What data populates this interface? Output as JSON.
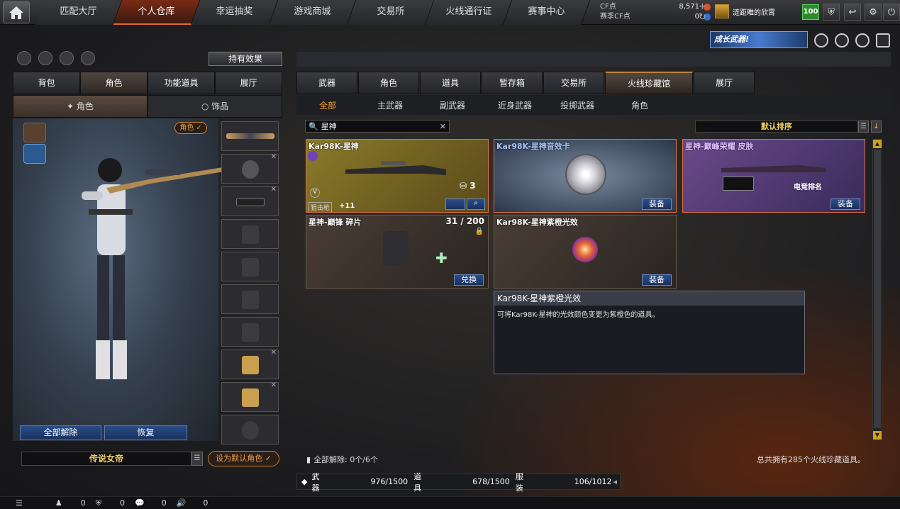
{
  "nav": {
    "tabs": [
      "匹配大厅",
      "个人仓库",
      "幸运抽奖",
      "游戏商城",
      "交易所",
      "火线通行证",
      "赛事中心"
    ],
    "active": 1
  },
  "currency": {
    "cf_label": "CF点",
    "cf_value": "8,571",
    "event_label": "赛季CF点",
    "event_value": "0"
  },
  "user": {
    "name": "涟距睢的欣霄",
    "level": "100"
  },
  "banner": {
    "text": "成长武器!"
  },
  "left": {
    "effect_button": "持有效果",
    "tabs": [
      "背包",
      "角色",
      "功能道具",
      "展厅"
    ],
    "active_tab": 1,
    "subtabs": [
      "角色",
      "饰品"
    ],
    "active_subtab": 0,
    "role_tag": "角色 ✓",
    "unequip_all": "全部解除",
    "restore": "恢复",
    "character_name": "传说女帝",
    "set_default": "设为默认角色 ✓"
  },
  "right": {
    "tabs": [
      "武器",
      "角色",
      "道具",
      "暂存箱",
      "交易所",
      "火线珍藏馆",
      "展厅"
    ],
    "active_tab": 5,
    "subtabs": [
      "全部",
      "主武器",
      "副武器",
      "近身武器",
      "投掷武器",
      "角色"
    ],
    "active_subtab": 0,
    "search_value": "星神",
    "sort_label": "默认排序",
    "items": [
      {
        "name": "Kar98K-星神",
        "badge": "3",
        "grade": "狙击枪",
        "plus": "+11"
      },
      {
        "name": "Kar98K-星神音效卡",
        "button": "装备"
      },
      {
        "name": "星神-巅峰荣耀 皮肤",
        "button": "装备",
        "badge_text": "电竞排名"
      },
      {
        "name": "星神-巅锋 碎片",
        "count": "31 / 200",
        "button": "兑换"
      },
      {
        "name": "Kar98K-星神紫橙光效",
        "button": "装备"
      }
    ],
    "tooltip": {
      "title": "Kar98K-星神紫橙光效",
      "desc": "可将Kar98K-星神的光效颜色变更为紫橙色的道具。"
    },
    "unequip_status": "全部解除: 0个/6个",
    "total": "总共拥有285个火线珍藏道具。",
    "storage": [
      {
        "label": "武器",
        "value": "976/1500"
      },
      {
        "label": "道具",
        "value": "678/1500"
      },
      {
        "label": "服装",
        "value": "106/1012"
      }
    ]
  },
  "statusbar": {
    "friends": "0",
    "guild": "0",
    "chat": "0",
    "voice": "0"
  }
}
